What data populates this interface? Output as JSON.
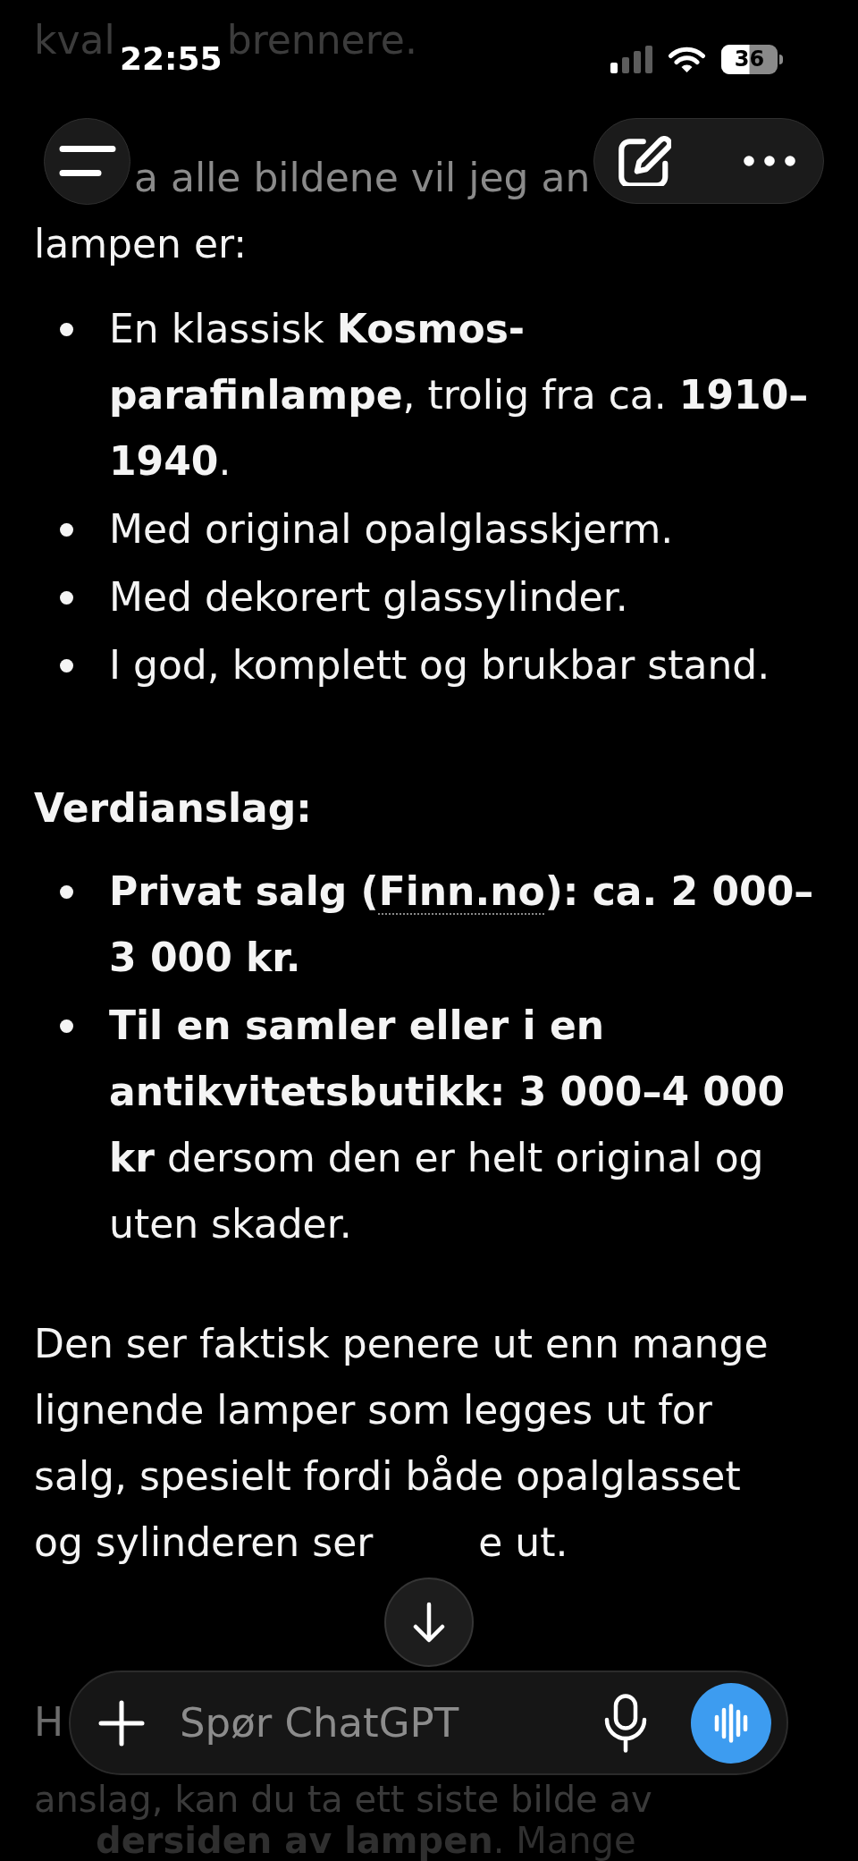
{
  "status_bar": {
    "time": "22:55",
    "battery": "36"
  },
  "message": {
    "top_fragments": [
      "kval",
      "brennere."
    ],
    "intro_fragment": "a alle bildene vil jeg an",
    "intro_tail": "lampen er:",
    "features": [
      "En klassisk **Kosmos-parafinlampe**, trolig fra ca. **1910–1940**.",
      "Med original opalglasskjerm.",
      "Med dekorert glassylinder.",
      "I god, komplett og brukbar stand."
    ],
    "heading": "Verdianslag:",
    "estimates": [
      {
        "bold": true,
        "parts": [
          {
            "kind": "text",
            "text": "Privat salg ("
          },
          {
            "kind": "link",
            "text": "Finn.no"
          },
          {
            "kind": "text",
            "text": "): ca. 2 000–3 000 kr."
          }
        ]
      },
      {
        "bold": false,
        "parts": [
          {
            "kind": "text",
            "text": "**Til en samler eller i en antikvitetsbutikk: 3 000–4 000 kr** dersom den er helt original og uten skader."
          }
        ]
      }
    ],
    "paragraph": "Den ser faktisk penere ut enn mange lignende lamper som legges ut for salg, spesielt fordi både opalglasset og sylinderen ser",
    "paragraph_tail": "e ut.",
    "bottom_fragment": "H",
    "bottom_lines": [
      "anslag, kan du ta ett siste bilde av",
      "**dersiden av lampen**. Mange"
    ]
  },
  "composer": {
    "placeholder": "Spør ChatGPT"
  }
}
